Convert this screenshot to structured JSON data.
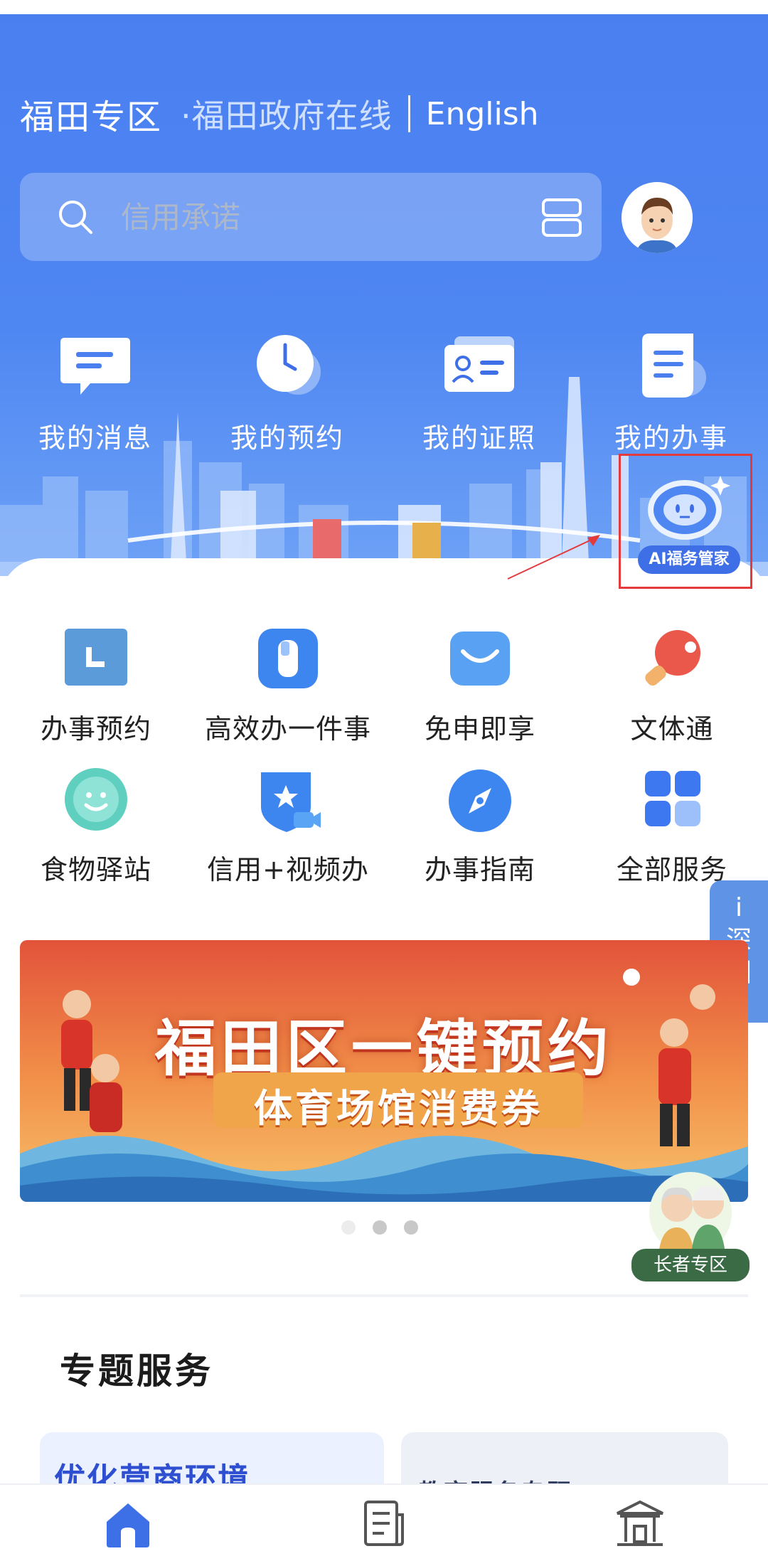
{
  "header": {
    "district": "福田专区",
    "portal": "·福田政府在线",
    "language": "English"
  },
  "search": {
    "placeholder": "信用承诺"
  },
  "quick_actions": [
    {
      "label": "我的消息",
      "icon": "message-icon"
    },
    {
      "label": "我的预约",
      "icon": "clock-icon"
    },
    {
      "label": "我的证照",
      "icon": "id-card-icon"
    },
    {
      "label": "我的办事",
      "icon": "document-icon"
    }
  ],
  "ai_assistant": {
    "label": "AI福务管家",
    "icon": "robot-icon"
  },
  "services": [
    {
      "label": "办事预约",
      "icon": "appointment-icon"
    },
    {
      "label": "高效办一件事",
      "icon": "one-thing-icon"
    },
    {
      "label": "免申即享",
      "icon": "mail-icon"
    },
    {
      "label": "文体通",
      "icon": "ping-pong-icon"
    },
    {
      "label": "食物驿站",
      "icon": "smile-badge-icon"
    },
    {
      "label": "信用+视频办",
      "icon": "shield-video-icon"
    },
    {
      "label": "办事指南",
      "icon": "compass-icon"
    },
    {
      "label": "全部服务",
      "icon": "grid-icon"
    }
  ],
  "side_tab": {
    "label_1": "i",
    "label_2": "深",
    "label_3": "圳"
  },
  "banner": {
    "title": "福田区一键预约",
    "subtitle": "体育场馆消费券",
    "active_index": 1,
    "total": 3
  },
  "elder_zone": {
    "label": "长者专区"
  },
  "topics": {
    "title": "专题服务",
    "cards": [
      {
        "title": "优化营商环境"
      },
      {
        "title": "教育服务专题"
      }
    ]
  },
  "tabbar": [
    {
      "icon": "home-icon",
      "active": true
    },
    {
      "icon": "news-icon",
      "active": false
    },
    {
      "icon": "gov-hall-icon",
      "active": false
    }
  ],
  "colors": {
    "hero_blue": "#4a7ff0",
    "accent_blue": "#3f6fe6",
    "highlight_red": "#e33b3b"
  }
}
